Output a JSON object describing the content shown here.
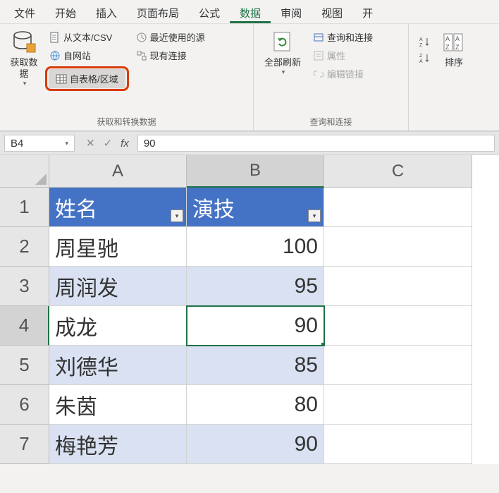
{
  "tabs": [
    "文件",
    "开始",
    "插入",
    "页面布局",
    "公式",
    "数据",
    "审阅",
    "视图",
    "开"
  ],
  "active_tab_index": 5,
  "ribbon": {
    "group1": {
      "label": "获取和转换数据",
      "get_data": "获取数\n据",
      "from_text_csv": "从文本/CSV",
      "from_web": "自网站",
      "from_table": "自表格/区域",
      "recent": "最近使用的源",
      "existing": "现有连接"
    },
    "group2": {
      "label": "查询和连接",
      "refresh_all": "全部刷新",
      "queries": "查询和连接",
      "properties": "属性",
      "edit_links": "编辑链接"
    },
    "group3": {
      "sort": "排序"
    }
  },
  "namebox": "B4",
  "formula": "90",
  "columns": [
    "A",
    "B",
    "C"
  ],
  "rows": [
    "1",
    "2",
    "3",
    "4",
    "5",
    "6",
    "7"
  ],
  "active": {
    "row_index": 3,
    "col_index": 1
  },
  "table": {
    "headers": [
      "姓名",
      "演技"
    ],
    "data": [
      {
        "name": "周星驰",
        "score": 100
      },
      {
        "name": "周润发",
        "score": 95
      },
      {
        "name": "成龙",
        "score": 90
      },
      {
        "name": "刘德华",
        "score": 85
      },
      {
        "name": "朱茵",
        "score": 80
      },
      {
        "name": "梅艳芳",
        "score": 90
      }
    ]
  }
}
